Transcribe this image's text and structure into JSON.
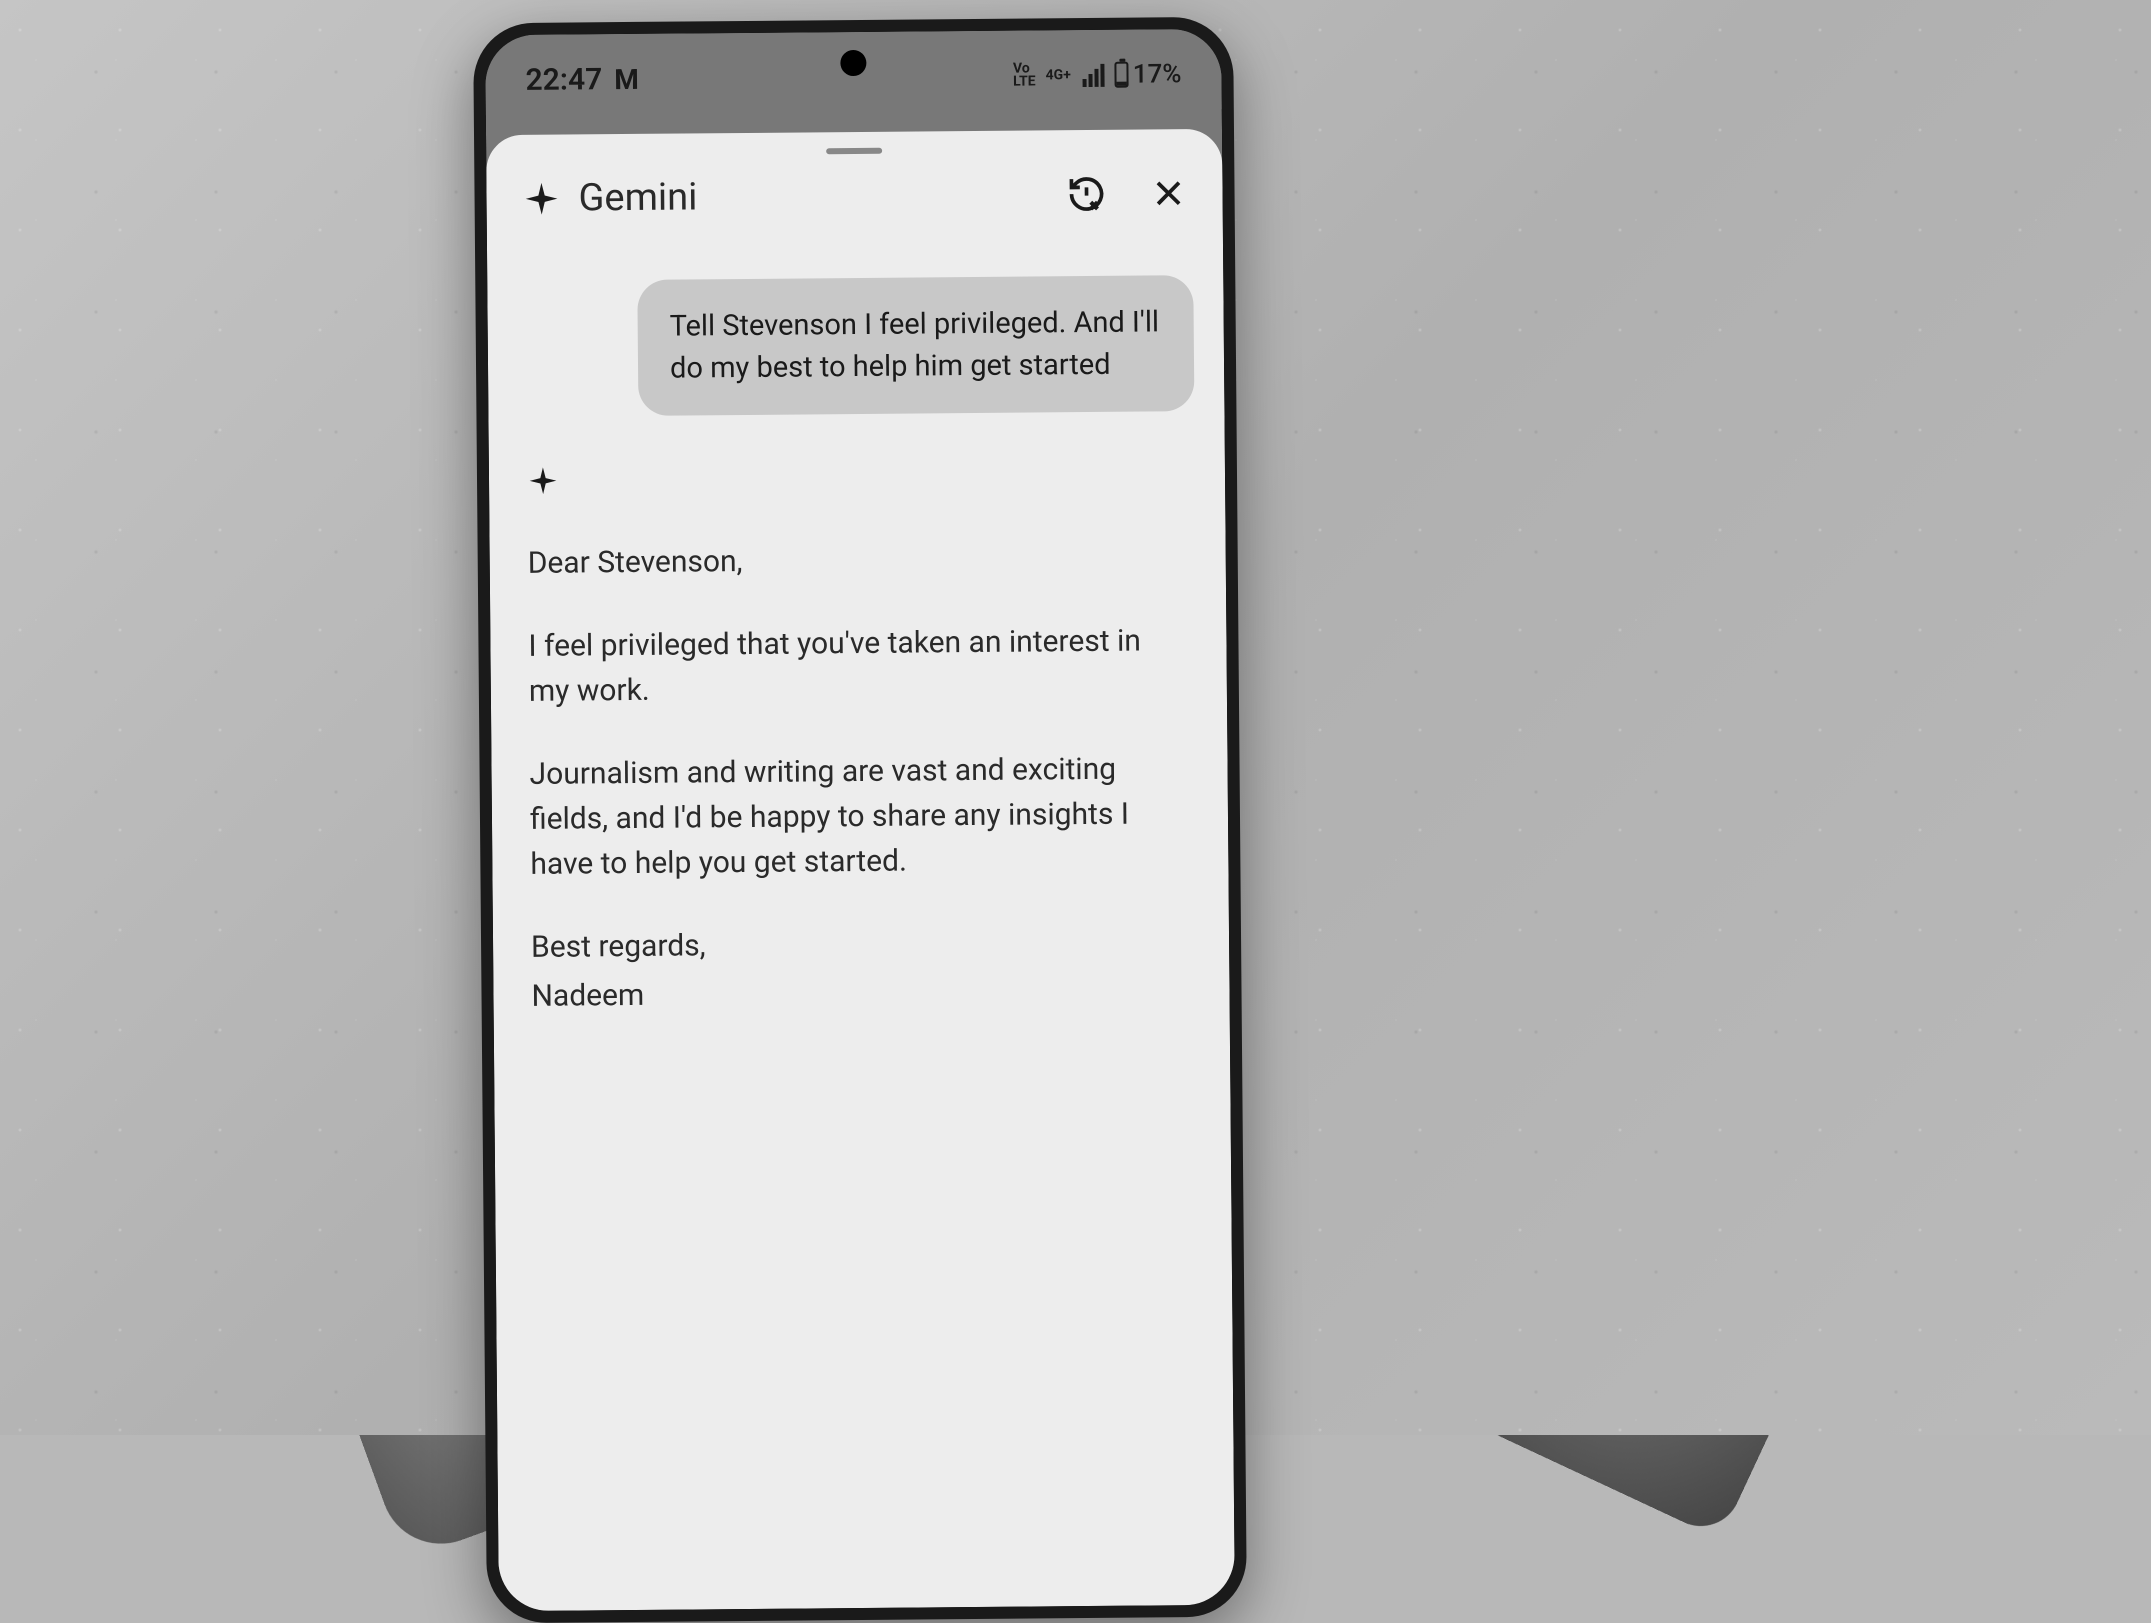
{
  "status_bar": {
    "time": "22:47",
    "gmail_indicator": "M",
    "volte": "Vo\nLTE",
    "network_type": "4G+",
    "battery_pct": "17%"
  },
  "app": {
    "title": "Gemini"
  },
  "chat": {
    "user_message": "Tell Stevenson I feel privileged. And I'll do my best to help him get started",
    "response": {
      "greeting": "Dear Stevenson,",
      "p1": "I feel privileged that you've taken an interest in my work.",
      "p2": "Journalism and writing are vast and exciting fields, and I'd be happy to share any insights I have to help you get started.",
      "signoff": "Best regards,",
      "name": "Nadeem"
    }
  }
}
